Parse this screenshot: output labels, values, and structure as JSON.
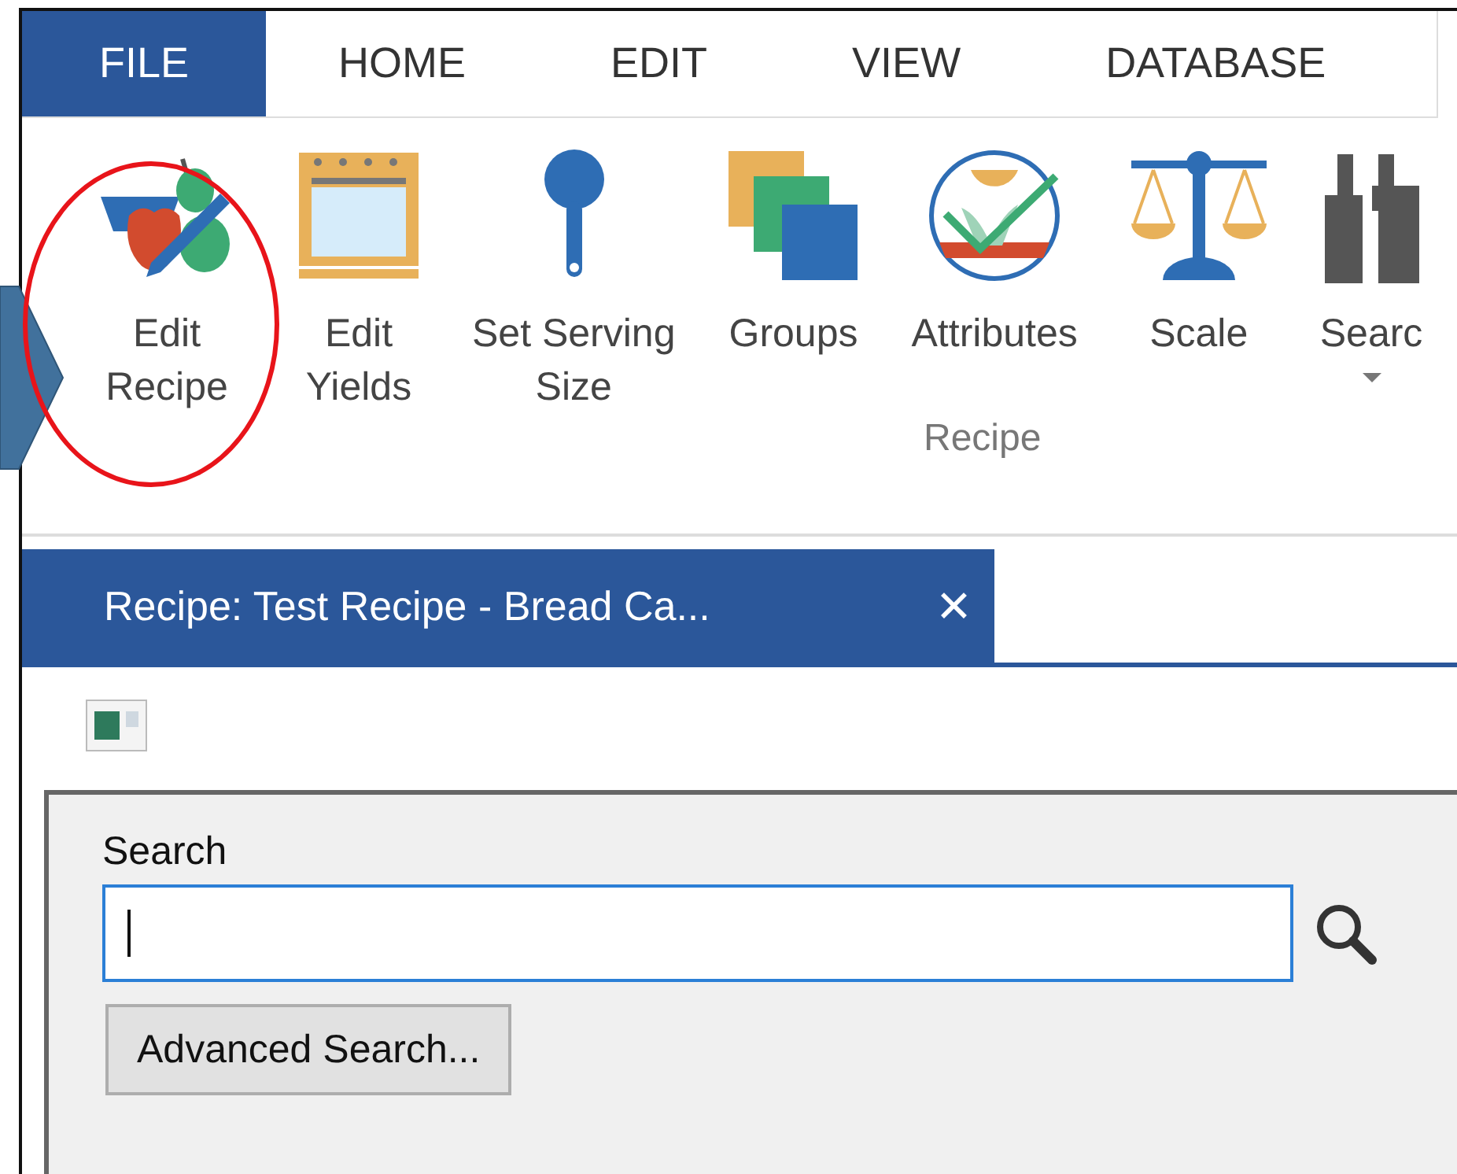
{
  "menu_tabs": [
    {
      "label": "FILE",
      "selected": true
    },
    {
      "label": "HOME",
      "selected": false
    },
    {
      "label": "EDIT",
      "selected": false
    },
    {
      "label": "VIEW",
      "selected": false
    },
    {
      "label": "DATABASE",
      "selected": false
    }
  ],
  "ribbon": {
    "group_label": "Recipe",
    "items": [
      {
        "kind": "edit-recipe",
        "lines": [
          "Edit",
          "Recipe"
        ],
        "dropdown": false
      },
      {
        "kind": "edit-yields",
        "lines": [
          "Edit",
          "Yields"
        ],
        "dropdown": false
      },
      {
        "kind": "serving-size",
        "lines": [
          "Set Serving",
          "Size"
        ],
        "dropdown": false
      },
      {
        "kind": "groups",
        "lines": [
          "Groups"
        ],
        "dropdown": false
      },
      {
        "kind": "attributes",
        "lines": [
          "Attributes"
        ],
        "dropdown": false
      },
      {
        "kind": "scale",
        "lines": [
          "Scale"
        ],
        "dropdown": false
      },
      {
        "kind": "search",
        "lines": [
          "Searc"
        ],
        "dropdown": true
      }
    ]
  },
  "document_tab": {
    "title": "Recipe: Test Recipe - Bread Ca...",
    "close": "✕",
    "selected": true
  },
  "search_panel": {
    "label": "Search",
    "field": {
      "focused": true
    },
    "advanced_button": "Advanced Search..."
  }
}
